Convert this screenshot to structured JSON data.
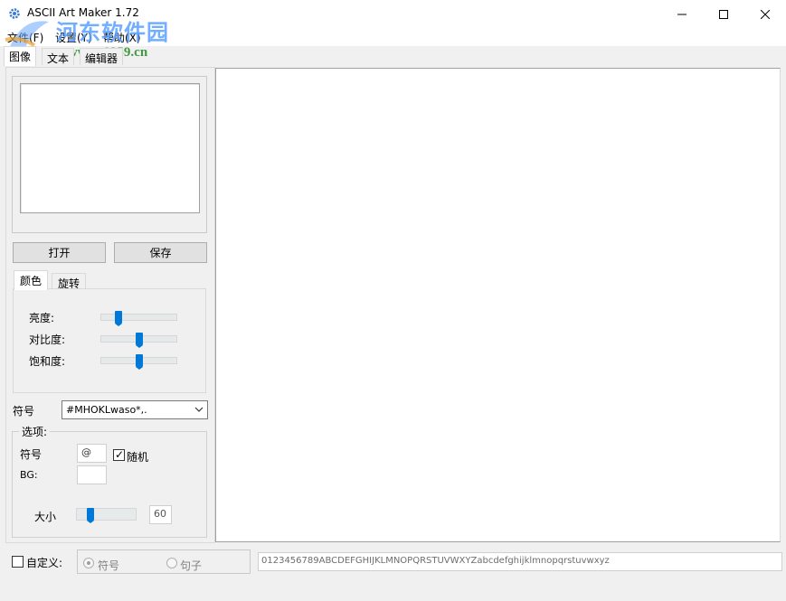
{
  "window": {
    "title": "ASCII Art Maker 1.72",
    "icons": {
      "app": "gear-icon",
      "minimize": "minimize-icon",
      "maximize": "maximize-icon",
      "close": "close-icon"
    }
  },
  "watermark": {
    "title": "河东软件园",
    "url": "www.pc0359.cn"
  },
  "menu": {
    "file": "文件(F)",
    "settings": "设置(Y)",
    "help": "帮助(X)"
  },
  "main_tabs": [
    "图像",
    "文本",
    "编辑器"
  ],
  "left_panel": {
    "open_button": "打开",
    "save_button": "保存",
    "sub_tabs": [
      "颜色",
      "旋转"
    ],
    "sliders": [
      {
        "label": "亮度:",
        "value_fraction": 0.2
      },
      {
        "label": "对比度:",
        "value_fraction": 0.5
      },
      {
        "label": "饱和度:",
        "value_fraction": 0.5
      }
    ],
    "symbol_label": "符号",
    "symbol_select": "#MHOKLwaso*,.",
    "options": {
      "title": "选项:",
      "symbol_label": "符号",
      "symbol_value": "@",
      "random_label": "随机",
      "random_checked": true,
      "bg_label": "BG:",
      "bg_value": "",
      "size_label": "大小",
      "size_fraction": 0.2,
      "size_value": "60"
    }
  },
  "bottom": {
    "custom_label": "自定义:",
    "custom_checked": false,
    "radio_symbol": "符号",
    "radio_sentence": "句子",
    "charset": "0123456789ABCDEFGHIJKLMNOPQRSTUVWXYZabcdefghijklmnopqrstuvwxyz"
  },
  "colors": {
    "slider_thumb": "#0078d7",
    "window_bg": "#f0f0f0",
    "canvas": "#ffffff"
  }
}
